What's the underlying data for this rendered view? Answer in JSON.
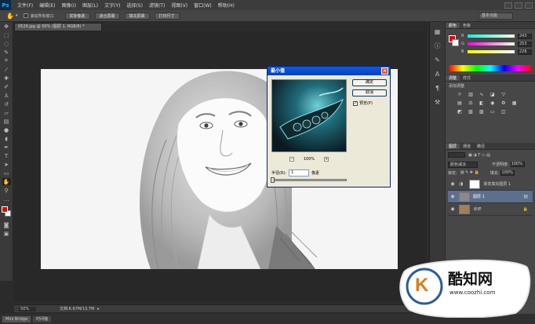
{
  "menubar": {
    "app_icon": "Ps",
    "items": [
      "文件(F)",
      "编辑(E)",
      "图像(I)",
      "图层(L)",
      "文字(Y)",
      "选择(S)",
      "滤镜(T)",
      "视图(V)",
      "窗口(W)",
      "帮助(H)"
    ]
  },
  "options": {
    "scroll_all_label": "滚动所有窗口",
    "buttons": [
      "实际像素",
      "适合屏幕",
      "填充屏幕",
      "打印尺寸"
    ],
    "workspace": "基本功能"
  },
  "document": {
    "tab_label": "0529.jpg @ 50% (图层 1, RGB/8) *",
    "zoom": "50%",
    "doc_info": "文档:6.67M/13.7M"
  },
  "bottom_tabs": [
    "Mini Bridge",
    "时间轴"
  ],
  "color_panel": {
    "tabs": [
      "颜色",
      "色板"
    ],
    "r": "243",
    "g": "253",
    "b": "226"
  },
  "adjust_panel": {
    "tabs": [
      "调整",
      "样式"
    ],
    "subtitle": "添加调整"
  },
  "layers_panel": {
    "tabs": [
      "图层",
      "通道",
      "路径"
    ],
    "blend_mode": "颜色减淡",
    "opacity_label": "不透明度:",
    "opacity": "100%",
    "lock_label": "锁定:",
    "fill_label": "填充:",
    "fill": "100%",
    "layers": [
      {
        "name": "渐变填充图层 1"
      },
      {
        "name": "图层 1"
      },
      {
        "name": "背景"
      }
    ]
  },
  "dialog": {
    "title": "最小值",
    "ok": "确定",
    "cancel": "取消",
    "preview_label": "预览(P)",
    "zoom": "100%",
    "radius_label": "半径(R):",
    "radius_value": "1",
    "unit": "像素"
  },
  "watermark": {
    "logo_letter": "K",
    "name": "酷知网",
    "url": "www.coozhi.com"
  }
}
